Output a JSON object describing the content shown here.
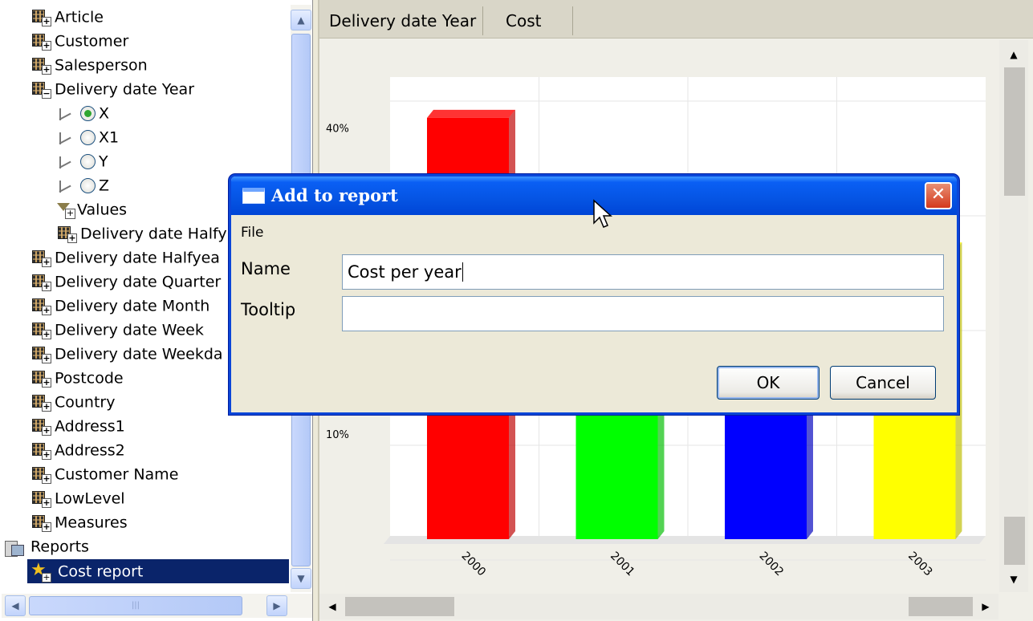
{
  "tree": {
    "items": [
      {
        "label": "Article",
        "icon": "cube-icon",
        "level": 0
      },
      {
        "label": "Customer",
        "icon": "cube-icon",
        "level": 0
      },
      {
        "label": "Salesperson",
        "icon": "cube-icon",
        "level": 0
      },
      {
        "label": "Delivery date Year",
        "icon": "cube-icon",
        "level": 0,
        "expanded": true
      },
      {
        "label": "X",
        "icon": "axis-x-icon",
        "level": 1,
        "radio": true,
        "checked": true
      },
      {
        "label": "X1",
        "icon": "axis-x1-icon",
        "level": 1,
        "radio": true
      },
      {
        "label": "Y",
        "icon": "axis-y-icon",
        "level": 1,
        "radio": true
      },
      {
        "label": "Z",
        "icon": "axis-z-icon",
        "level": 1,
        "radio": true
      },
      {
        "label": "Values",
        "icon": "filter-icon",
        "level": 1
      },
      {
        "label": "Delivery date Halfy",
        "icon": "cube-icon",
        "level": 1
      },
      {
        "label": "Delivery date Halfyea",
        "icon": "cube-icon",
        "level": 0
      },
      {
        "label": "Delivery date Quarter",
        "icon": "cube-icon",
        "level": 0
      },
      {
        "label": "Delivery date Month",
        "icon": "cube-icon",
        "level": 0
      },
      {
        "label": "Delivery date Week",
        "icon": "cube-icon",
        "level": 0
      },
      {
        "label": "Delivery date Weekda",
        "icon": "cube-icon",
        "level": 0
      },
      {
        "label": "Postcode",
        "icon": "cube-icon",
        "level": 0
      },
      {
        "label": "Country",
        "icon": "cube-icon",
        "level": 0
      },
      {
        "label": "Address1",
        "icon": "cube-icon",
        "level": 0
      },
      {
        "label": "Address2",
        "icon": "cube-icon",
        "level": 0
      },
      {
        "label": "Customer Name",
        "icon": "cube-icon",
        "level": 0
      },
      {
        "label": "LowLevel",
        "icon": "cube-icon",
        "level": 0
      },
      {
        "label": "Measures",
        "icon": "cube-icon",
        "level": 0
      }
    ],
    "reports_label": "Reports",
    "report_item": "Cost report"
  },
  "chart_header": {
    "dimension": "Delivery date Year",
    "measure": "Cost"
  },
  "chart_data": {
    "type": "bar",
    "categories": [
      "2000",
      "2001",
      "2002",
      "2003"
    ],
    "values": [
      41,
      28,
      28,
      28
    ],
    "colors": [
      "#ff0000",
      "#00ff00",
      "#0000ff",
      "#ffff00"
    ],
    "tick_labels": [
      "10%",
      "40%"
    ],
    "tick_values": [
      10,
      40
    ],
    "ylim": [
      0,
      45
    ],
    "grid": true
  },
  "dialog": {
    "title": "Add to report",
    "menu_file": "File",
    "name_label": "Name",
    "name_value": "Cost per year",
    "tooltip_label": "Tooltip",
    "tooltip_value": "",
    "ok_label": "OK",
    "cancel_label": "Cancel",
    "close_glyph": "✕"
  },
  "scroll_glyphs": {
    "up": "▲",
    "down": "▼",
    "left": "◀",
    "right": "▶",
    "grip": "|||"
  }
}
